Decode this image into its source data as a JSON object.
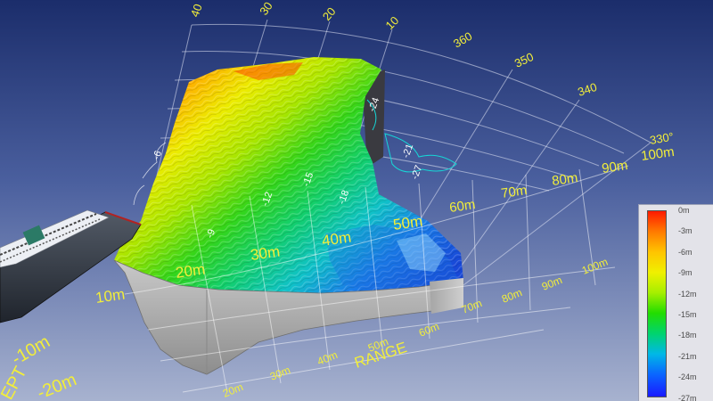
{
  "bearing_labels": [
    "40",
    "30",
    "20",
    "10",
    "360",
    "350",
    "340",
    "330°"
  ],
  "range_top_labels": [
    "10m",
    "20m",
    "30m",
    "40m",
    "50m",
    "60m",
    "70m",
    "80m",
    "90m",
    "100m"
  ],
  "range_side_labels": [
    "70m",
    "80m",
    "90m",
    "100m"
  ],
  "range_bottom_labels": [
    "20m",
    "30m",
    "40m",
    "50m",
    "60m"
  ],
  "range_title": "RANGE",
  "depth_axis_labels": [
    "EPT",
    "-10m",
    "-20m"
  ],
  "contour_labels": [
    "-6",
    "-9",
    "-12",
    "-15",
    "-18",
    "-21",
    "-24",
    "-27"
  ],
  "legend": {
    "labels": [
      "0m",
      "-3m",
      "-6m",
      "-9m",
      "-12m",
      "-15m",
      "-18m",
      "-21m",
      "-24m",
      "-27m"
    ],
    "colors": [
      "#ff1a00",
      "#ff7a00",
      "#ffc400",
      "#f0f000",
      "#a6ef00",
      "#22dd00",
      "#00d46e",
      "#00b8e6",
      "#0a66ff",
      "#1a1aff"
    ]
  }
}
